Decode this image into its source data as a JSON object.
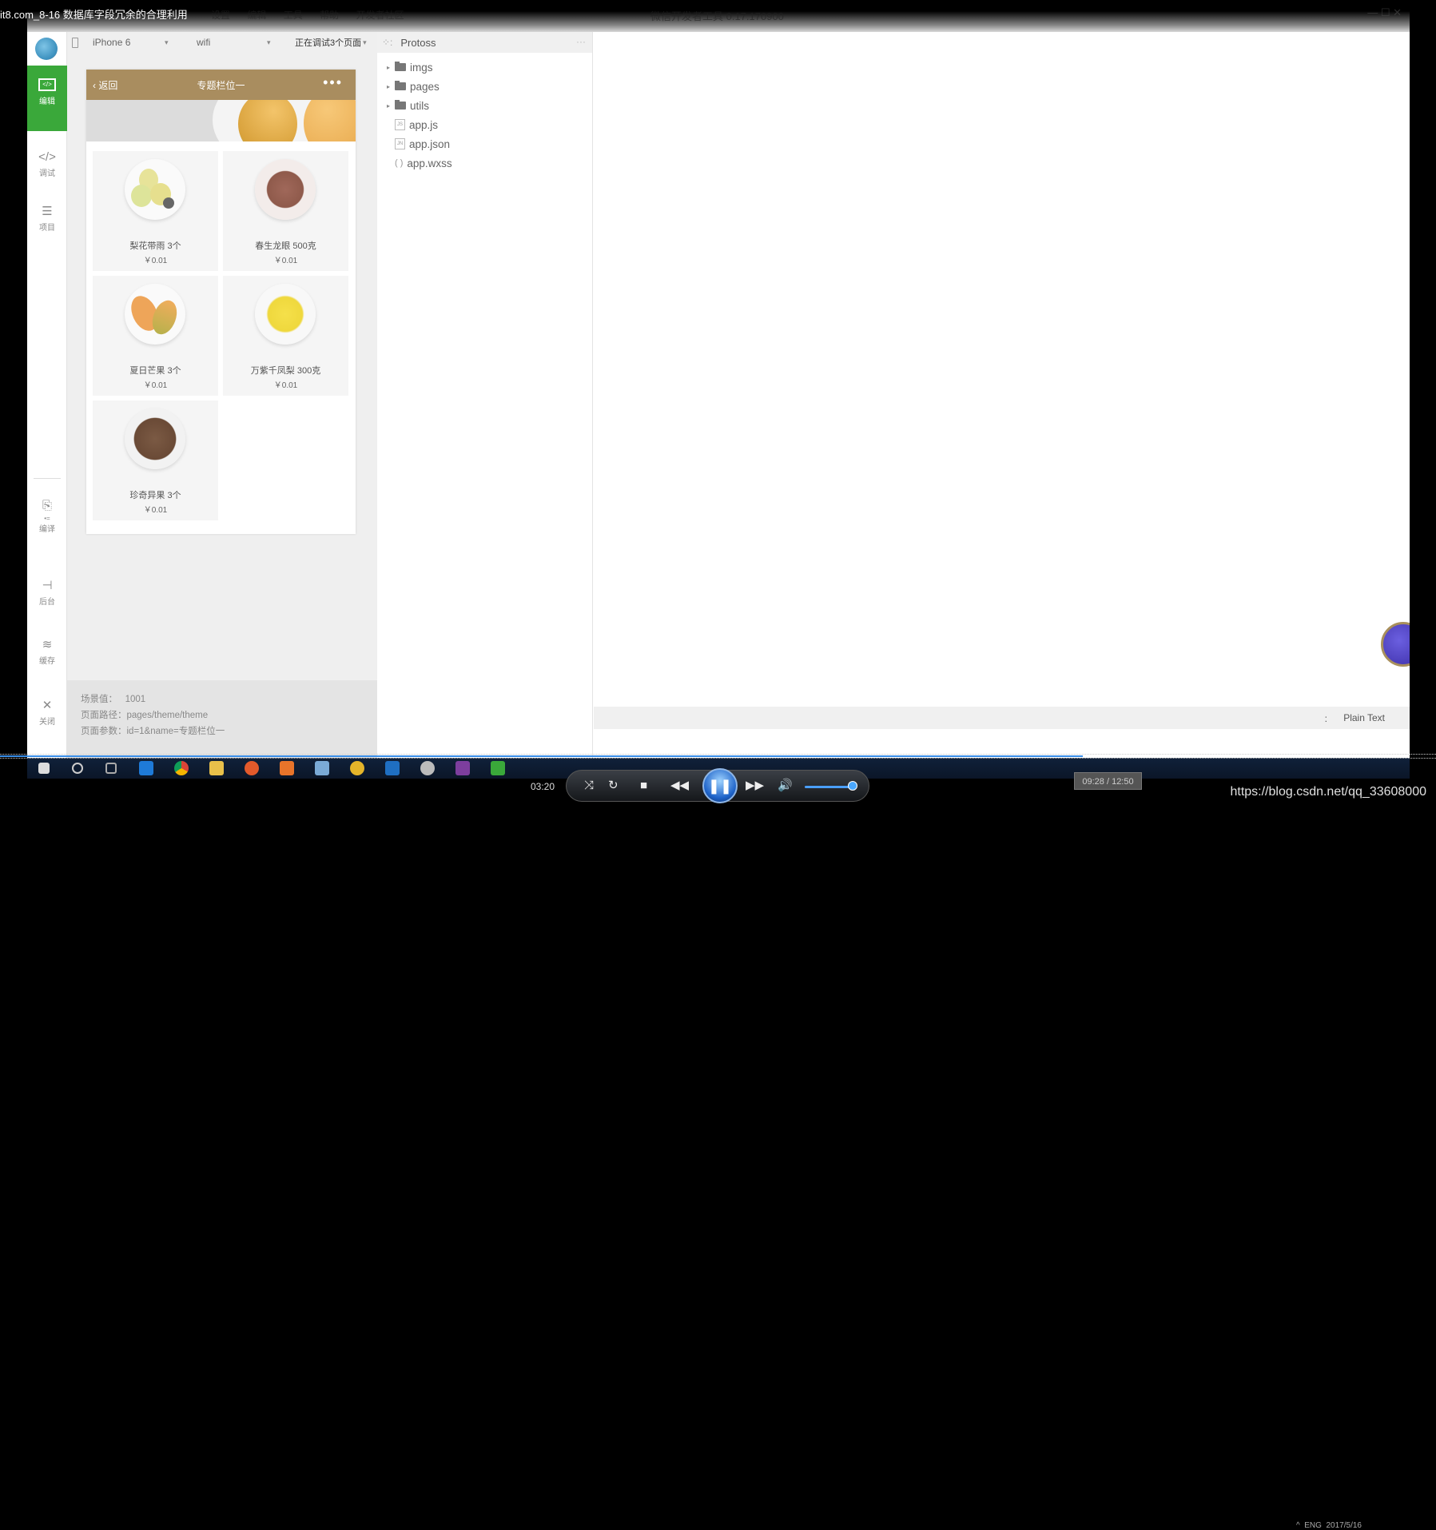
{
  "video_title": "it8.com_8-16 数据库字段冗余的合理利用",
  "menus": [
    "设置",
    "编辑",
    "工具",
    "帮助",
    "开发者社区"
  ],
  "app_title": "微信开发者工具 0.17.170900",
  "window_controls": "—  ☐  ✕",
  "sidebar": {
    "items": [
      {
        "label": "编辑",
        "icon": "editor-icon",
        "active": true
      },
      {
        "label": "调试",
        "icon": "code-icon",
        "active": false
      },
      {
        "label": "项目",
        "icon": "menu-lines-icon",
        "active": false
      },
      {
        "label": "编译",
        "icon": "compile-icon",
        "active": false
      },
      {
        "label": "后台",
        "icon": "backend-icon",
        "active": false
      },
      {
        "label": "缓存",
        "icon": "layers-icon",
        "active": false
      },
      {
        "label": "关闭",
        "icon": "close-icon",
        "active": false
      }
    ]
  },
  "simulator": {
    "device": "iPhone 6",
    "network": "wifi",
    "debug_status": "正在调试3个页面",
    "navbar": {
      "back": "返回",
      "title": "专题栏位一",
      "more": "•••",
      "color": "#a98d5f"
    },
    "products": [
      {
        "name": "梨花带雨 3个",
        "price": "￥0.01"
      },
      {
        "name": "春生龙眼 500克",
        "price": "￥0.01"
      },
      {
        "name": "夏日芒果 3个",
        "price": "￥0.01"
      },
      {
        "name": "万紫千凤梨 300克",
        "price": "￥0.01"
      },
      {
        "name": "珍奇异果 3个",
        "price": "￥0.01"
      }
    ],
    "info": {
      "scene_label": "场景值：",
      "scene_value": "1001",
      "path_label": "页面路径：",
      "path_value": "pages/theme/theme",
      "params_label": "页面参数：",
      "params_value": "id=1&name=专题栏位一"
    }
  },
  "file_tree": {
    "project": "Protoss",
    "items": [
      {
        "name": "imgs",
        "type": "folder"
      },
      {
        "name": "pages",
        "type": "folder"
      },
      {
        "name": "utils",
        "type": "folder"
      },
      {
        "name": "app.js",
        "type": "js"
      },
      {
        "name": "app.json",
        "type": "json"
      },
      {
        "name": "app.wxss",
        "type": "wxss"
      }
    ]
  },
  "editor_status": {
    "separator": ":",
    "language": "Plain Text"
  },
  "tray": {
    "lang": "ENG",
    "date": "2017/5/16"
  },
  "player": {
    "current_time": "03:20",
    "tooltip": "09:28 / 12:50",
    "progress": 0.754,
    "volume": 0.9
  },
  "watermark_url": "https://blog.csdn.net/qq_33608000"
}
